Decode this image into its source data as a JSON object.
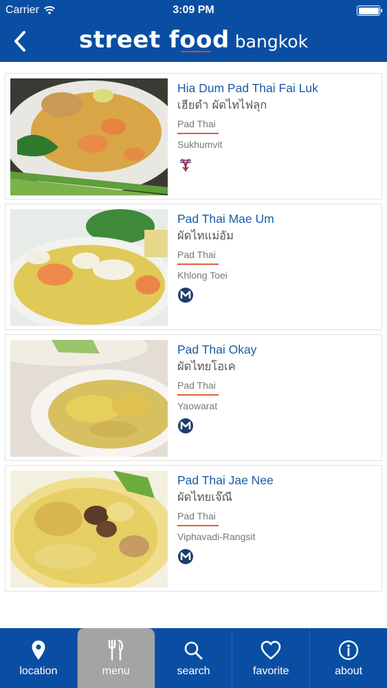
{
  "status_bar": {
    "carrier": "Carrier",
    "time": "3:09 PM"
  },
  "header": {
    "brand_primary_start": "street f",
    "brand_primary_oo": "oo",
    "brand_primary_end": "d",
    "brand_secondary": "bangkok"
  },
  "colors": {
    "brand_blue": "#0a4ea3",
    "link_blue": "#1b5aa8",
    "accent_red": "#e15b3c",
    "active_tab": "#a4a4a4"
  },
  "restaurants": [
    {
      "name": "Hia Dum Pad Thai Fai Luk",
      "thai_name": "เฮียดำ ผัดไทไฟลุก",
      "category": "Pad Thai",
      "area": "Sukhumvit",
      "transit_icon": "bts-icon"
    },
    {
      "name": "Pad Thai Mae Um",
      "thai_name": "ผัดไทแม่อัม",
      "category": "Pad Thai",
      "area": "Khlong Toei",
      "transit_icon": "mrt-icon"
    },
    {
      "name": "Pad Thai Okay",
      "thai_name": "ผัดไทยโอเค",
      "category": "Pad Thai",
      "area": "Yaowarat",
      "transit_icon": "mrt-icon"
    },
    {
      "name": "Pad Thai Jae Nee",
      "thai_name": "ผัดไทยเจ๊ณี",
      "category": "Pad Thai",
      "area": "Viphavadi-Rangsit",
      "transit_icon": "mrt-icon"
    }
  ],
  "tabs": [
    {
      "label": "location",
      "icon": "location-pin-icon",
      "active": false
    },
    {
      "label": "menu",
      "icon": "fork-knife-icon",
      "active": true
    },
    {
      "label": "search",
      "icon": "search-icon",
      "active": false
    },
    {
      "label": "favorite",
      "icon": "heart-icon",
      "active": false
    },
    {
      "label": "about",
      "icon": "info-icon",
      "active": false
    }
  ]
}
